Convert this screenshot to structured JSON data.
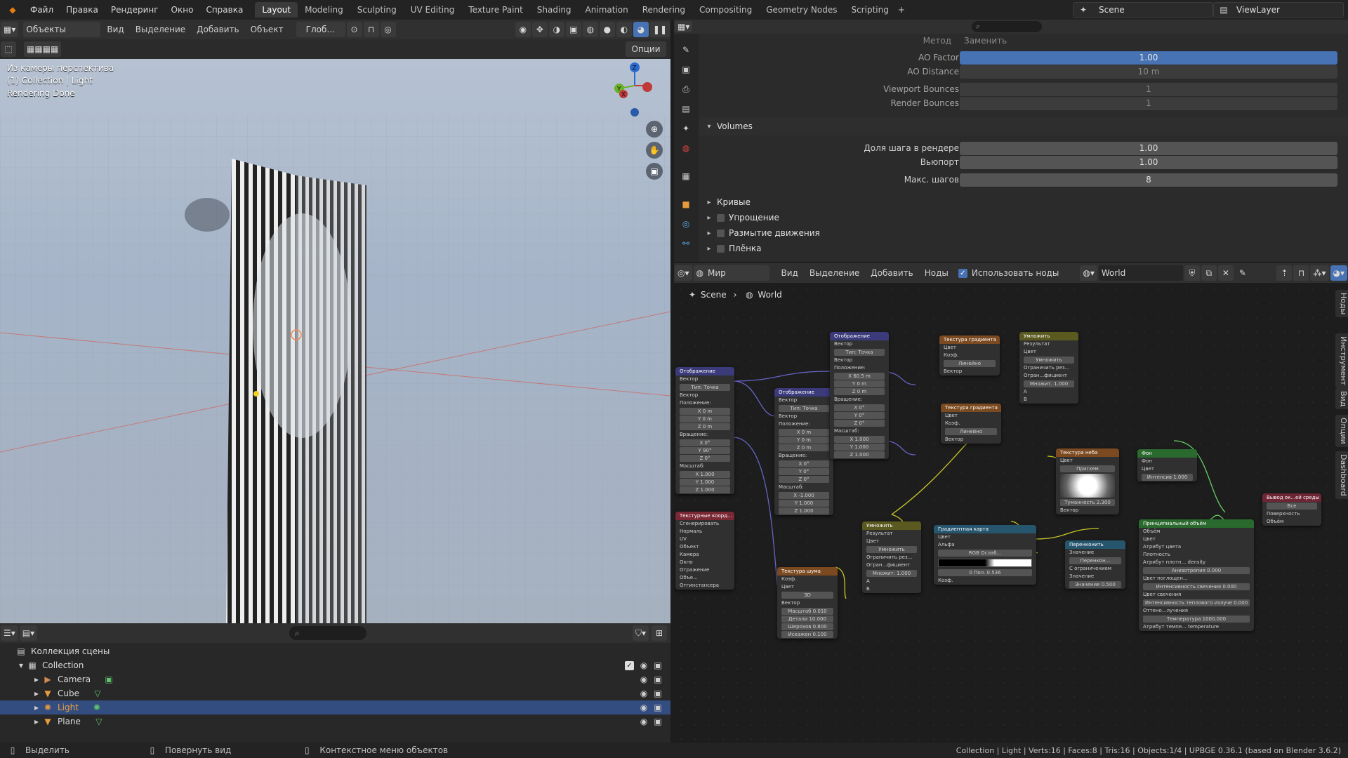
{
  "menu": [
    "Файл",
    "Правка",
    "Рендеринг",
    "Окно",
    "Справка"
  ],
  "workspaces": [
    "Layout",
    "Modeling",
    "Sculpting",
    "UV Editing",
    "Texture Paint",
    "Shading",
    "Animation",
    "Rendering",
    "Compositing",
    "Geometry Nodes",
    "Scripting"
  ],
  "active_workspace": "Layout",
  "scene": "Scene",
  "view_layer": "ViewLayer",
  "viewport": {
    "mode": "Объекты",
    "menus": [
      "Вид",
      "Выделение",
      "Добавить",
      "Объект"
    ],
    "transform": "Глоб…",
    "options": "Опции",
    "info": [
      "Из камеры перспектива",
      "(1) Collection | Light",
      "Rendering Done"
    ],
    "gizmo": {
      "z": "Z",
      "y": "Y",
      "x": "X"
    }
  },
  "outliner": {
    "root": "Коллекция сцены",
    "collection": "Collection",
    "items": [
      {
        "name": "Camera",
        "icon": "camera-icon",
        "color": "#d58a50"
      },
      {
        "name": "Cube",
        "icon": "mesh-icon",
        "color": "#e69b3c"
      },
      {
        "name": "Light",
        "icon": "light-icon",
        "color": "#e69b3c"
      },
      {
        "name": "Plane",
        "icon": "mesh-icon",
        "color": "#e69b3c"
      }
    ],
    "selected": "Light"
  },
  "properties": {
    "method_label": "Метод",
    "method_value": "Заменить",
    "rows": [
      {
        "label": "AO Factor",
        "value": "1.00",
        "style": "blue"
      },
      {
        "label": "AO Distance",
        "value": "10 m",
        "style": "dim"
      },
      {
        "label": "Viewport Bounces",
        "value": "1",
        "style": "dim"
      },
      {
        "label": "Render Bounces",
        "value": "1",
        "style": "dim"
      }
    ],
    "volumes_title": "Volumes",
    "volume_rows": [
      {
        "label": "Доля шага в рендере",
        "value": "1.00"
      },
      {
        "label": "Вьюпорт",
        "value": "1.00"
      },
      {
        "label": "Макс. шагов",
        "value": "8"
      }
    ],
    "collapsed": [
      "Кривые",
      "Упрощение",
      "Размытие движения",
      "Плёнка"
    ]
  },
  "node_editor": {
    "type": "Мир",
    "menus": [
      "Вид",
      "Выделение",
      "Добавить",
      "Ноды"
    ],
    "use_nodes_label": "Использовать ноды",
    "world_name": "World",
    "breadcrumb": [
      "Scene",
      "World"
    ],
    "side_tabs": [
      "Ноды",
      "Инструмент",
      "Вид",
      "Опции",
      "Dashboard"
    ],
    "nodes": {
      "map1": {
        "title": "Отображение",
        "rows": [
          "Вектор",
          "Тип:  Точка",
          "Вектор",
          "Положение:",
          "X  0 m",
          "Y  0 m",
          "Z  0 m",
          "Вращение:",
          "X  0°",
          "Y  90°",
          "Z  0°",
          "Масштаб:",
          "X  1.000",
          "Y  1.000",
          "Z  1.000"
        ]
      },
      "map2": {
        "title": "Отображение",
        "rows": [
          "Вектор",
          "Тип:  Точка",
          "Вектор",
          "Положение:",
          "X  0 m",
          "Y  0 m",
          "Z  0 m",
          "Вращение:",
          "X  0°",
          "Y  0°",
          "Z  0°",
          "Масштаб:",
          "X  -1.000",
          "Y  1.000",
          "Z  1.000"
        ]
      },
      "map3": {
        "title": "Отображение",
        "rows": [
          "Вектор",
          "Тип:  Точка",
          "Вектор",
          "Положение:",
          "X  60.5 m",
          "Y  0 m",
          "Z  0 m",
          "Вращение:",
          "X  0°",
          "Y  0°",
          "Z  0°",
          "Масштаб:",
          "X  1.000",
          "Y  1.000",
          "Z  1.000"
        ]
      },
      "grad1": {
        "title": "Текстура градиента",
        "rows": [
          "Цвет",
          "Коэф.",
          "Линейно",
          "Вектор"
        ]
      },
      "grad2": {
        "title": "Текстура градиента",
        "rows": [
          "Цвет",
          "Коэф.",
          "Линейно",
          "Вектор"
        ]
      },
      "mult1": {
        "title": "Умножить",
        "rows": [
          "Результат",
          "Цвет",
          "Умножить",
          "Ограничить рез...",
          "Огран...фициент",
          "Множит. 1.000",
          "A",
          "B"
        ]
      },
      "mult2": {
        "title": "Умножить",
        "rows": [
          "Результат",
          "Цвет",
          "Умножить",
          "Ограничить рез...",
          "Огран...фициент",
          "Множит. 1.000",
          "A",
          "B"
        ]
      },
      "texcoord": {
        "title": "Текстурные коорд...",
        "rows": [
          "Сгенерировать",
          "Нормаль",
          "UV",
          "Объект",
          "Камера",
          "Окно",
          "Отражение",
          "Объе...",
          "Отгинстансера"
        ]
      },
      "noise": {
        "title": "Текстура шума",
        "rows": [
          "Коэф.",
          "Цвет",
          "3D",
          "Вектор",
          "Масштаб  0.010",
          "Детали  10.000",
          "Шерохов  0.800",
          "Искажен  0.100"
        ]
      },
      "sky": {
        "title": "Текстура неба",
        "rows": [
          "Цвет",
          "Пригхем",
          "Туманность 2.300",
          "Вектор"
        ]
      },
      "bg": {
        "title": "Фон",
        "rows": [
          "Фон",
          "Цвет",
          "Интенсив 1.000"
        ]
      },
      "ramp": {
        "title": "Градиентная карта",
        "rows": [
          "Цвет",
          "Альфа",
          "RGB   Ослаб...",
          "0     Пол.  0.536",
          "Коэф."
        ]
      },
      "mapr": {
        "title": "Перенконить",
        "rows": [
          "Значение",
          "Перенкон...",
          "С ограничением",
          "Значение",
          "Значение 0.500"
        ]
      },
      "vol": {
        "title": "Принципиальный объём",
        "rows": [
          "Объём",
          "Цвет",
          "Атрибут цвета",
          "Плотность",
          "Атрибут плотн...  density",
          "Анизотропия  0.000",
          "Цвет поглощен...",
          "Интенсивность свечения  0.000",
          "Цвет свечения",
          "Интенсивность теплового излуче  0.000",
          "Оттено...лучения",
          "Температура  1000.000",
          "Атрибут темпе...  temperature"
        ]
      },
      "out": {
        "title": "Вывод ок...ей среды",
        "rows": [
          "Все",
          "Поверхность",
          "Объём"
        ]
      }
    }
  },
  "status": {
    "left": [
      "Выделить",
      "Повернуть вид",
      "Контекстное меню объектов"
    ],
    "right": "Collection | Light | Verts:16 | Faces:8 | Tris:16 | Objects:1/4 | UPBGE 0.36.1 (based on Blender 3.6.2)"
  }
}
